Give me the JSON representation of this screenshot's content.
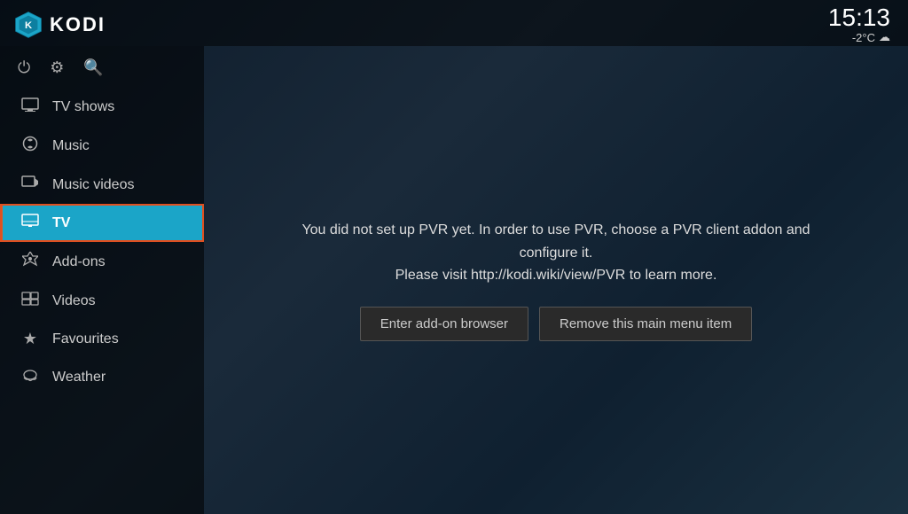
{
  "header": {
    "app_name": "KODI",
    "clock": "15:13",
    "weather_temp": "-2°C",
    "weather_icon": "☁"
  },
  "sidebar": {
    "controls": [
      {
        "name": "power-icon",
        "symbol": "⏻"
      },
      {
        "name": "settings-icon",
        "symbol": "⚙"
      },
      {
        "name": "search-icon",
        "symbol": "🔍"
      }
    ],
    "items": [
      {
        "id": "tv-shows",
        "label": "TV shows",
        "icon": "🖥",
        "active": false
      },
      {
        "id": "music",
        "label": "Music",
        "icon": "🎧",
        "active": false
      },
      {
        "id": "music-videos",
        "label": "Music videos",
        "icon": "🎞",
        "active": false
      },
      {
        "id": "tv",
        "label": "TV",
        "icon": "📺",
        "active": true
      },
      {
        "id": "add-ons",
        "label": "Add-ons",
        "icon": "🎓",
        "active": false
      },
      {
        "id": "videos",
        "label": "Videos",
        "icon": "⊞",
        "active": false
      },
      {
        "id": "favourites",
        "label": "Favourites",
        "icon": "★",
        "active": false
      },
      {
        "id": "weather",
        "label": "Weather",
        "icon": "⛅",
        "active": false
      }
    ]
  },
  "pvr_panel": {
    "message_line1": "You did not set up PVR yet. In order to use PVR, choose a PVR client addon and configure it.",
    "message_line2": "Please visit http://kodi.wiki/view/PVR to learn more.",
    "button_addon_browser": "Enter add-on browser",
    "button_remove": "Remove this main menu item"
  }
}
